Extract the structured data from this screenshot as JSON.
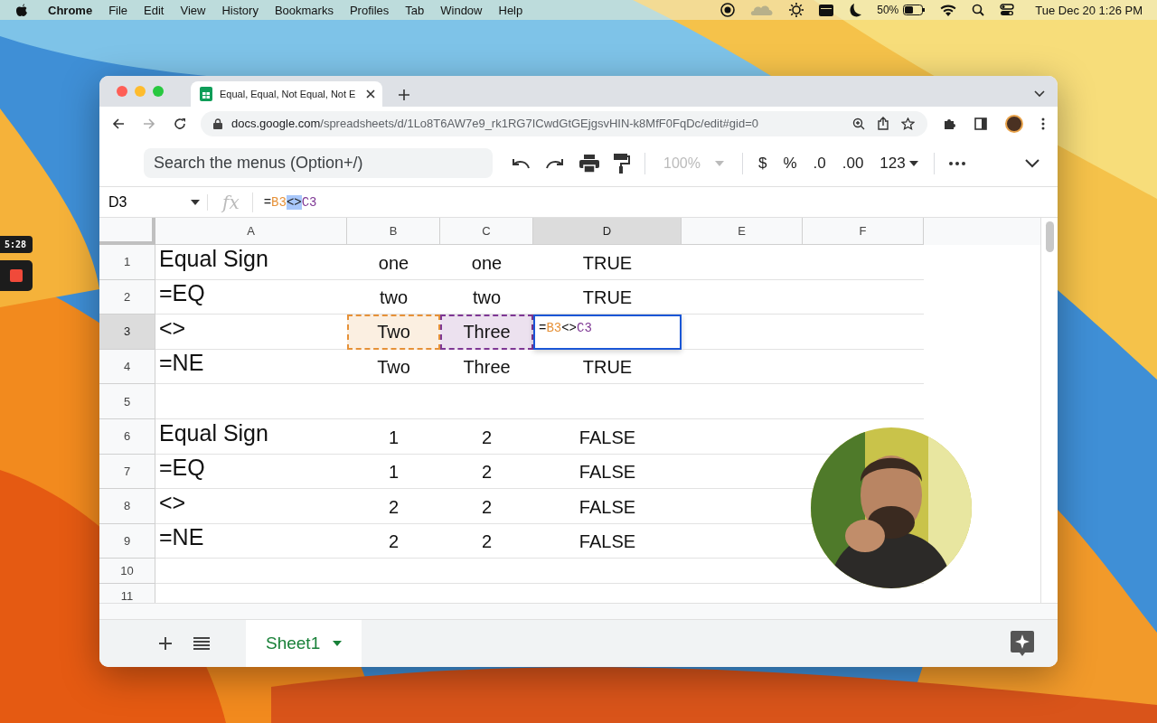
{
  "menu_bar": {
    "app": "Chrome",
    "items": [
      "File",
      "Edit",
      "View",
      "History",
      "Bookmarks",
      "Profiles",
      "Tab",
      "Window",
      "Help"
    ],
    "battery": "50%",
    "clock": "Tue Dec 20  1:26 PM"
  },
  "recorder": {
    "timer": "5:28"
  },
  "browser": {
    "tabs": [
      {
        "title": "Equal, Equal, Not Equal, Not E",
        "selected": true
      }
    ],
    "url_host": "docs.google.com",
    "url_path": "/spreadsheets/d/1Lo8T6AW7e9_rk1RG7ICwdGtGEjgsvHIN-k8MfF0FqDc/edit#gid=0"
  },
  "toolbar": {
    "search": {
      "placeholder": "Search the menus (Option+/)"
    },
    "zoom": {
      "text": "100%",
      "disabled": true
    },
    "formats": [
      "$",
      "%",
      ".0",
      ".00",
      "123"
    ]
  },
  "formula_bar": {
    "name_box": "D3",
    "fx": "fx",
    "formula": [
      {
        "text": "=",
        "kind": "op",
        "selected": false
      },
      {
        "text": "B3",
        "kind": "ref",
        "color": "#e69138",
        "selected": false
      },
      {
        "text": "<>",
        "kind": "op",
        "selected": true
      },
      {
        "text": "C3",
        "kind": "ref",
        "color": "#7e3794",
        "selected": false
      }
    ]
  },
  "columns": [
    {
      "label": "A",
      "selected": false
    },
    {
      "label": "B",
      "selected": false
    },
    {
      "label": "C",
      "selected": false
    },
    {
      "label": "D",
      "selected": true
    },
    {
      "label": "E",
      "selected": false
    },
    {
      "label": "F",
      "selected": false
    }
  ],
  "rows": [
    {
      "number": "1",
      "selected": false,
      "cells": [
        {
          "kind": "text",
          "text": "Equal Sign"
        },
        {
          "kind": "text",
          "text": "one"
        },
        {
          "kind": "text",
          "text": "one"
        },
        {
          "kind": "text",
          "text": "TRUE"
        }
      ]
    },
    {
      "number": "2",
      "selected": false,
      "cells": [
        {
          "kind": "text",
          "text": "=EQ"
        },
        {
          "kind": "text",
          "text": "two"
        },
        {
          "kind": "text",
          "text": "two"
        },
        {
          "kind": "text",
          "text": "TRUE"
        }
      ]
    },
    {
      "number": "3",
      "selected": true,
      "cells": [
        {
          "kind": "text",
          "text": "<>"
        },
        {
          "kind": "ref",
          "text": "Two",
          "color": "#e69138"
        },
        {
          "kind": "ref",
          "text": "Three",
          "color": "#7e3794"
        },
        {
          "kind": "editor",
          "formula": [
            {
              "text": "=",
              "kind": "op"
            },
            {
              "text": "B3",
              "kind": "ref",
              "color": "#e69138"
            },
            {
              "text": "<>",
              "kind": "op"
            },
            {
              "text": "C3",
              "kind": "ref",
              "color": "#7e3794"
            }
          ]
        }
      ]
    },
    {
      "number": "4",
      "selected": false,
      "cells": [
        {
          "kind": "text",
          "text": "=NE"
        },
        {
          "kind": "text",
          "text": "Two"
        },
        {
          "kind": "text",
          "text": "Three"
        },
        {
          "kind": "text",
          "text": "TRUE"
        }
      ]
    },
    {
      "number": "5",
      "selected": false
    },
    {
      "number": "6",
      "selected": false,
      "cells": [
        {
          "kind": "text",
          "text": "Equal Sign"
        },
        {
          "kind": "text",
          "text": "1"
        },
        {
          "kind": "text",
          "text": "2"
        },
        {
          "kind": "text",
          "text": "FALSE"
        }
      ]
    },
    {
      "number": "7",
      "selected": false,
      "cells": [
        {
          "kind": "text",
          "text": "=EQ"
        },
        {
          "kind": "text",
          "text": "1"
        },
        {
          "kind": "text",
          "text": "2"
        },
        {
          "kind": "text",
          "text": "FALSE"
        }
      ]
    },
    {
      "number": "8",
      "selected": false,
      "cells": [
        {
          "kind": "text",
          "text": "<>"
        },
        {
          "kind": "text",
          "text": "2"
        },
        {
          "kind": "text",
          "text": "2"
        },
        {
          "kind": "text",
          "text": "FALSE"
        }
      ]
    },
    {
      "number": "9",
      "selected": false,
      "cells": [
        {
          "kind": "text",
          "text": "=NE"
        },
        {
          "kind": "text",
          "text": "2"
        },
        {
          "kind": "text",
          "text": "2"
        },
        {
          "kind": "text",
          "text": "FALSE"
        }
      ]
    },
    {
      "number": "10",
      "selected": false
    },
    {
      "number": "11",
      "selected": false
    }
  ],
  "sheet_tabs": [
    {
      "label": "Sheet1",
      "selected": true
    }
  ]
}
